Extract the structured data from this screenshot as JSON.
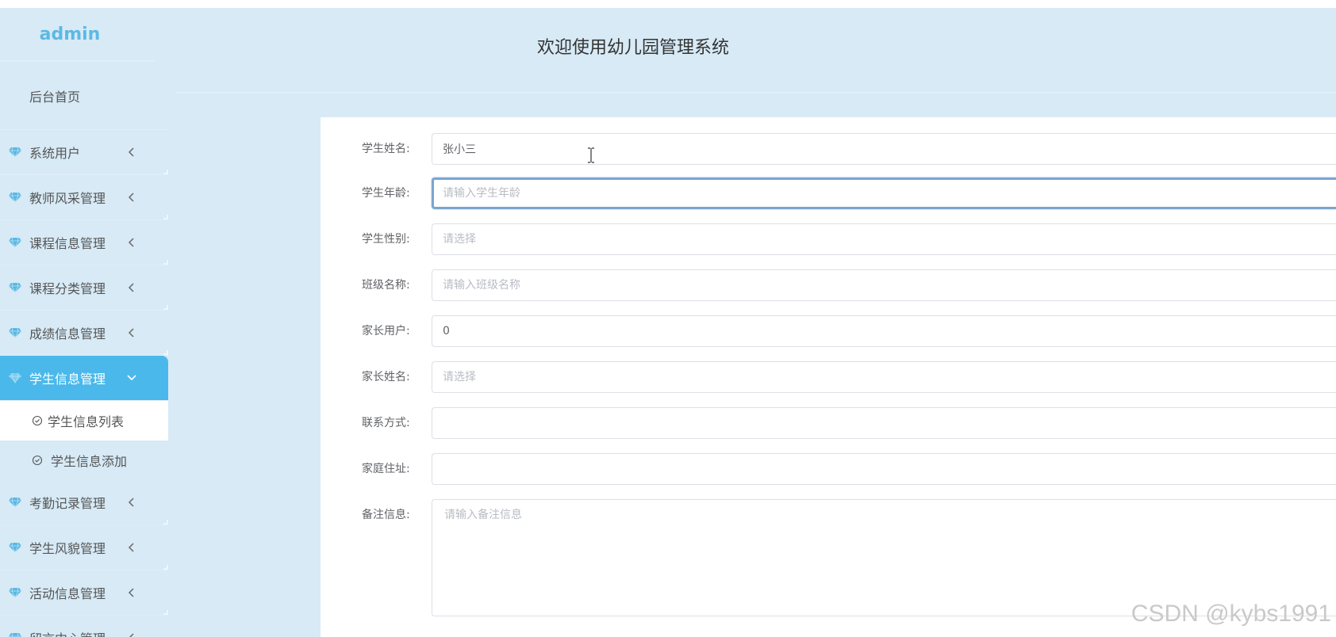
{
  "app": {
    "brand": "admin",
    "header_title": "欢迎使用幼儿园管理系统"
  },
  "sidebar": {
    "home": "后台首页",
    "items": [
      {
        "label": "系统用户",
        "icon": "gem-icon",
        "arrow": "chevron-left-icon"
      },
      {
        "label": "教师风采管理",
        "icon": "gem-icon",
        "arrow": "chevron-left-icon"
      },
      {
        "label": "课程信息管理",
        "icon": "gem-icon",
        "arrow": "chevron-left-icon"
      },
      {
        "label": "课程分类管理",
        "icon": "gem-icon",
        "arrow": "chevron-left-icon"
      },
      {
        "label": "成绩信息管理",
        "icon": "gem-icon",
        "arrow": "chevron-left-icon"
      },
      {
        "label": "学生信息管理",
        "icon": "gem-icon",
        "arrow": "chevron-down-icon",
        "active": true
      },
      {
        "label": "考勤记录管理",
        "icon": "gem-icon",
        "arrow": "chevron-left-icon"
      },
      {
        "label": "学生风貌管理",
        "icon": "gem-icon",
        "arrow": "chevron-left-icon"
      },
      {
        "label": "活动信息管理",
        "icon": "gem-icon",
        "arrow": "chevron-left-icon"
      },
      {
        "label": "留言中心管理",
        "icon": "gem-icon",
        "arrow": "chevron-left-icon"
      }
    ],
    "subitems": [
      {
        "label": "学生信息列表",
        "icon": "check-circle-icon",
        "selected": true
      },
      {
        "label": "学生信息添加",
        "icon": "check-circle-icon"
      }
    ]
  },
  "form": {
    "fields": [
      {
        "label": "学生姓名:",
        "value": "张小三",
        "placeholder": ""
      },
      {
        "label": "学生年龄:",
        "value": "",
        "placeholder": "请输入学生年龄"
      },
      {
        "label": "学生性别:",
        "value": "",
        "placeholder": "请选择"
      },
      {
        "label": "班级名称:",
        "value": "",
        "placeholder": "请输入班级名称"
      },
      {
        "label": "家长用户:",
        "value": "0",
        "placeholder": ""
      },
      {
        "label": "家长姓名:",
        "value": "",
        "placeholder": "请选择"
      },
      {
        "label": "联系方式:",
        "value": "",
        "placeholder": ""
      },
      {
        "label": "家庭住址:",
        "value": "",
        "placeholder": ""
      }
    ],
    "remark": {
      "label": "备注信息:",
      "value": "",
      "placeholder": "请输入备注信息"
    }
  },
  "watermark": "CSDN @kybs1991",
  "colors": {
    "background": "#d7eaf6",
    "brand": "#5db9e3",
    "active_menu": "#4ab8ea",
    "focus_border": "#7aa6cf"
  }
}
